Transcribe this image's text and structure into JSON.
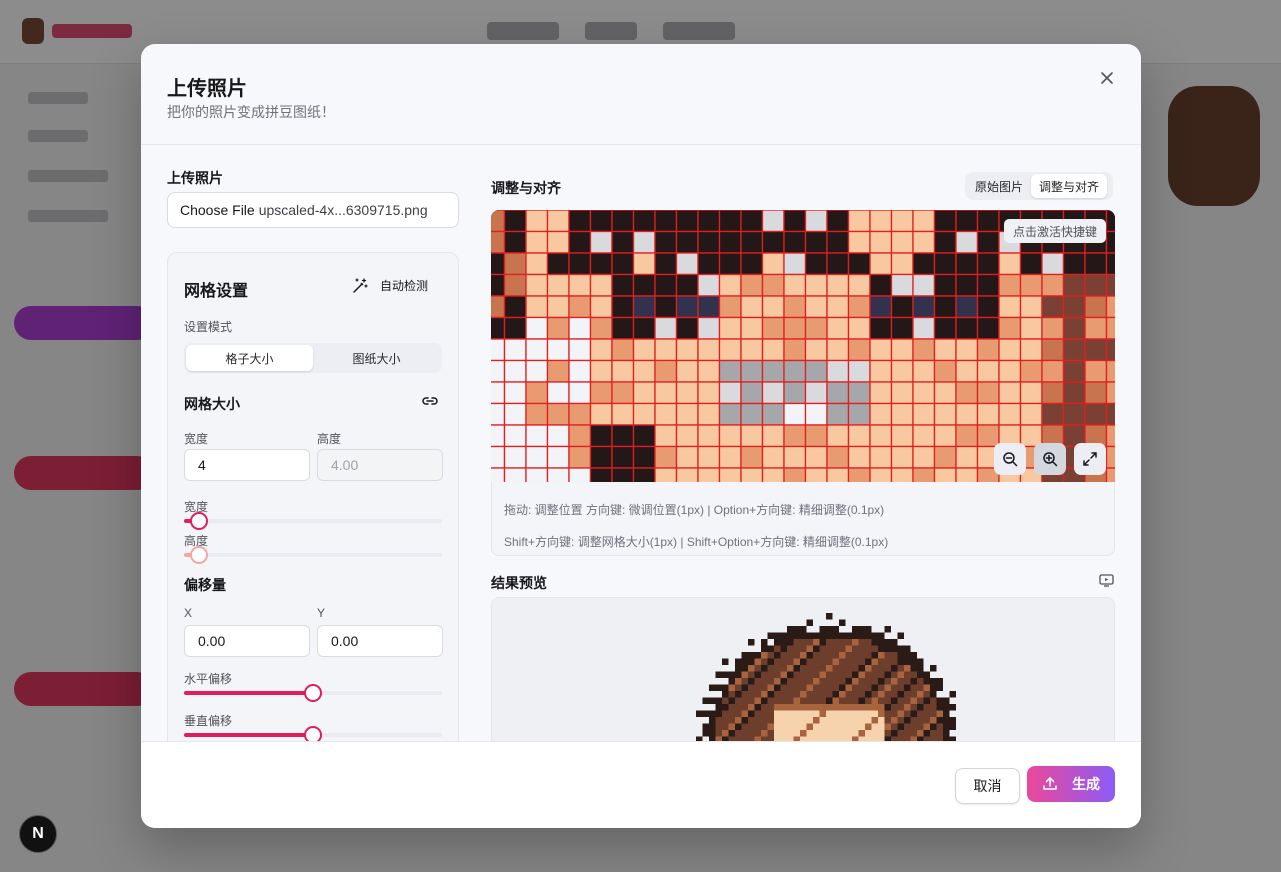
{
  "modal": {
    "title": "上传照片",
    "subtitle": "把你的照片变成拼豆图纸！",
    "close_icon": "×"
  },
  "upload": {
    "label": "上传照片",
    "button": "Choose File",
    "file_name": "upscaled-4x...6309715.png"
  },
  "grid_settings": {
    "title": "网格设置",
    "auto_detect": "自动检测",
    "mode_label": "设置模式",
    "modes": [
      "格子大小",
      "图纸大小"
    ],
    "active_mode": "格子大小",
    "grid_size_title": "网格大小",
    "width_label": "宽度",
    "height_label": "高度",
    "width_value": "4",
    "height_value": "4.00",
    "width_slider_label": "宽度",
    "height_slider_label": "高度",
    "width_slider_fraction": 0.06,
    "height_slider_fraction": 0.06,
    "offset_title": "偏移量",
    "x_label": "X",
    "y_label": "Y",
    "x_value": "0.00",
    "y_value": "0.00",
    "h_offset_label": "水平偏移",
    "v_offset_label": "垂直偏移",
    "h_offset_fraction": 0.5,
    "v_offset_fraction": 0.5
  },
  "align": {
    "title": "调整与对齐",
    "views": [
      "原始图片",
      "调整与对齐"
    ],
    "active_view": "调整与对齐",
    "shortcut_badge": "点击激活快捷键",
    "hint_line1": "拖动: 调整位置     方向键: 微调位置(1px) | Option+方向键: 精细调整(0.1px)",
    "hint_line2": "Shift+方向键: 调整网格大小(1px) | Shift+Option+方向键: 精细调整(0.1px)",
    "zoom_buttons": [
      "zoom-out-icon",
      "zoom-in-icon",
      "fullscreen-icon"
    ]
  },
  "preview": {
    "title": "结果预览",
    "icon": "tv-icon"
  },
  "footer": {
    "cancel": "取消",
    "generate": "生成"
  },
  "colors": {
    "accent": "#e11d5b",
    "grid_line": "#e0201f",
    "generate_from": "#ec4899",
    "generate_to": "#8b5cf6"
  },
  "badge": "N"
}
